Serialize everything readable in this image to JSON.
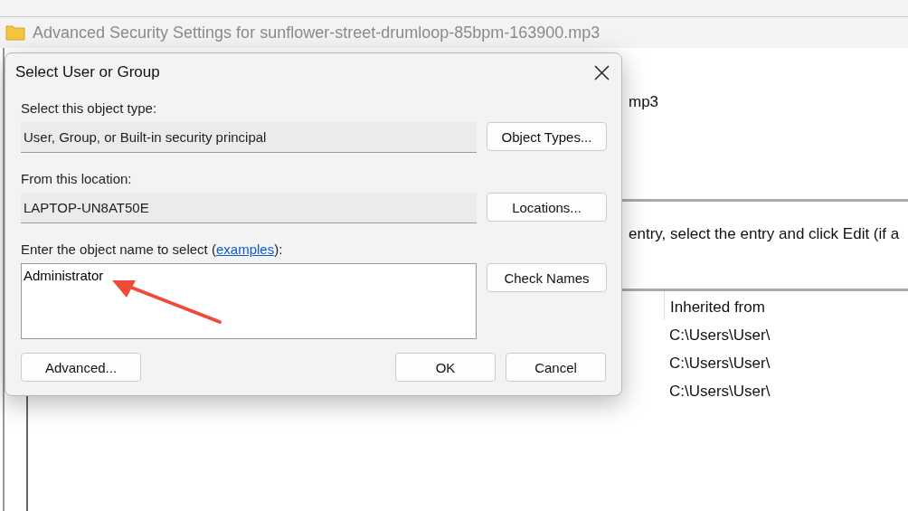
{
  "background_window": {
    "title": "Advanced Security Settings for sunflower-street-drumloop-85bpm-163900.mp3",
    "name_fragment": "mp3",
    "instruction_fragment": "entry, select the entry and click Edit (if a",
    "table": {
      "columns": [
        "Inherited from"
      ],
      "rows": [
        {
          "inherited_from": "C:\\Users\\User\\"
        },
        {
          "inherited_from": "C:\\Users\\User\\"
        },
        {
          "inherited_from": "C:\\Users\\User\\"
        }
      ]
    }
  },
  "dialog": {
    "title": "Select User or Group",
    "sections": [
      {
        "label": "Select this object type:",
        "value": "User, Group, or Built-in security principal",
        "button": "Object Types..."
      },
      {
        "label": "From this location:",
        "value": "LAPTOP-UN8AT50E",
        "button": "Locations..."
      }
    ],
    "name_label": {
      "before": "Enter the object name to select (",
      "link": "examples",
      "after": "):"
    },
    "name_value": "Administrator",
    "check_button": "Check Names",
    "buttons": [
      {
        "label": "Advanced...",
        "kind": "left"
      },
      {
        "label": "OK",
        "kind": "right"
      },
      {
        "label": "Cancel",
        "kind": "right"
      }
    ]
  }
}
